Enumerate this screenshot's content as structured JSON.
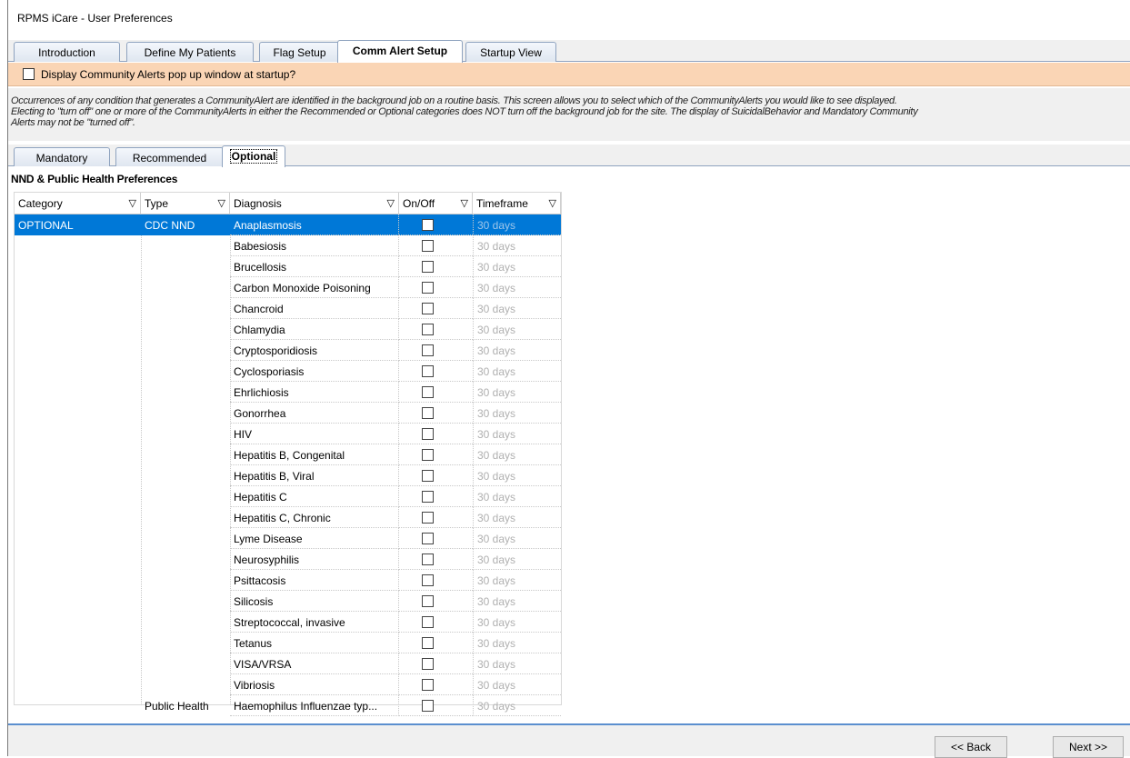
{
  "window": {
    "title": "RPMS iCare - User Preferences"
  },
  "top_tabs": [
    "Introduction",
    "Define My Patients",
    "Flag Setup",
    "Comm Alert Setup",
    "Startup View"
  ],
  "active_top_tab": "Comm Alert Setup",
  "popup_option": {
    "label": "Display Community Alerts pop up window at startup?",
    "checked": false
  },
  "description": {
    "line1": "Occurrences of any condition that generates a  CommunityAlert are identified in the background job on a  routine basis.  This screen allows you to select which of the CommunityAlerts you would like to see displayed.",
    "line2": "Electing to \"turn off\"  one or more of the CommunityAlerts in either the Recommended or Optional categories does NOT turn off the background job for the site.  The display of SuicidalBehavior and Mandatory Community",
    "line3": "Alerts may not be \"turned off\"."
  },
  "sub_tabs": [
    "Mandatory",
    "Recommended",
    "Optional"
  ],
  "active_sub_tab": "Optional",
  "panel": {
    "title": "NND & Public Health Preferences"
  },
  "grid": {
    "columns": [
      "Category",
      "Type",
      "Diagnosis",
      "On/Off",
      "Timeframe"
    ],
    "rows": [
      {
        "category": "OPTIONAL",
        "type": "CDC NND",
        "diagnosis": "Anaplasmosis",
        "on": false,
        "timeframe": "30 days"
      },
      {
        "category": "",
        "type": "",
        "diagnosis": "Babesiosis",
        "on": false,
        "timeframe": "30 days"
      },
      {
        "category": "",
        "type": "",
        "diagnosis": "Brucellosis",
        "on": false,
        "timeframe": "30 days"
      },
      {
        "category": "",
        "type": "",
        "diagnosis": "Carbon Monoxide Poisoning",
        "on": false,
        "timeframe": "30 days"
      },
      {
        "category": "",
        "type": "",
        "diagnosis": "Chancroid",
        "on": false,
        "timeframe": "30 days"
      },
      {
        "category": "",
        "type": "",
        "diagnosis": "Chlamydia",
        "on": false,
        "timeframe": "30 days"
      },
      {
        "category": "",
        "type": "",
        "diagnosis": "Cryptosporidiosis",
        "on": false,
        "timeframe": "30 days"
      },
      {
        "category": "",
        "type": "",
        "diagnosis": "Cyclosporiasis",
        "on": false,
        "timeframe": "30 days"
      },
      {
        "category": "",
        "type": "",
        "diagnosis": "Ehrlichiosis",
        "on": false,
        "timeframe": "30 days"
      },
      {
        "category": "",
        "type": "",
        "diagnosis": "Gonorrhea",
        "on": false,
        "timeframe": "30 days"
      },
      {
        "category": "",
        "type": "",
        "diagnosis": "HIV",
        "on": false,
        "timeframe": "30 days"
      },
      {
        "category": "",
        "type": "",
        "diagnosis": "Hepatitis B, Congenital",
        "on": false,
        "timeframe": "30 days"
      },
      {
        "category": "",
        "type": "",
        "diagnosis": "Hepatitis B, Viral",
        "on": false,
        "timeframe": "30 days"
      },
      {
        "category": "",
        "type": "",
        "diagnosis": "Hepatitis C",
        "on": false,
        "timeframe": "30 days"
      },
      {
        "category": "",
        "type": "",
        "diagnosis": "Hepatitis C, Chronic",
        "on": false,
        "timeframe": "30 days"
      },
      {
        "category": "",
        "type": "",
        "diagnosis": "Lyme Disease",
        "on": false,
        "timeframe": "30 days"
      },
      {
        "category": "",
        "type": "",
        "diagnosis": "Neurosyphilis",
        "on": false,
        "timeframe": "30 days"
      },
      {
        "category": "",
        "type": "",
        "diagnosis": "Psittacosis",
        "on": false,
        "timeframe": "30 days"
      },
      {
        "category": "",
        "type": "",
        "diagnosis": "Silicosis",
        "on": false,
        "timeframe": "30 days"
      },
      {
        "category": "",
        "type": "",
        "diagnosis": "Streptococcal, invasive",
        "on": false,
        "timeframe": "30 days"
      },
      {
        "category": "",
        "type": "",
        "diagnosis": "Tetanus",
        "on": false,
        "timeframe": "30 days"
      },
      {
        "category": "",
        "type": "",
        "diagnosis": "VISA/VRSA",
        "on": false,
        "timeframe": "30 days"
      },
      {
        "category": "",
        "type": "",
        "diagnosis": "Vibriosis",
        "on": false,
        "timeframe": "30 days"
      },
      {
        "category": "",
        "type": "Public Health",
        "diagnosis": "Haemophilus Influenzae typ...",
        "on": false,
        "timeframe": "30 days"
      }
    ],
    "selected_row": 0
  },
  "footer": {
    "back_label": "<< Back",
    "next_label": "Next >>"
  },
  "colors": {
    "alert_bar": "#fad5b5",
    "selection": "#0078d7",
    "tab_border": "#8fa3bf"
  },
  "icons": {
    "column_filter": "filter-icon"
  }
}
